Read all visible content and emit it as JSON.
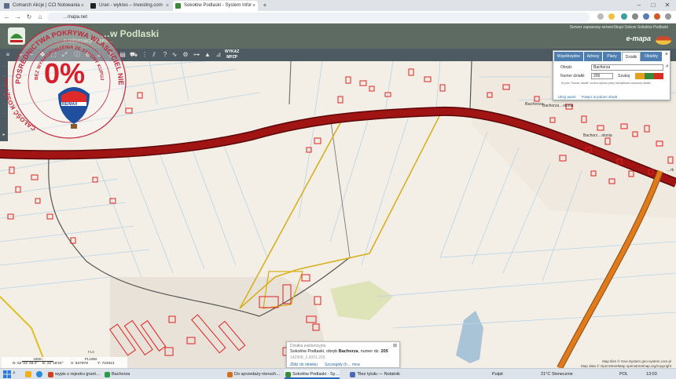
{
  "browser": {
    "tabs": [
      {
        "title": "Comarch Akcje | CCI Notowania",
        "favicon_color": "#5b6b8a"
      },
      {
        "title": "Uran - wykres – Investing.com",
        "favicon_color": "#222222"
      },
      {
        "title": "Sokołów Podlaski - System Infor",
        "favicon_color": "#3a8a3a",
        "active": true
      }
    ],
    "new_tab": "+",
    "address": "…mapa.net",
    "window_controls": [
      "–",
      "□",
      "✕"
    ]
  },
  "site": {
    "title": "…w Podlaski",
    "subtitle": "…n Informacji Przes…",
    "note": "Serwer zapasowy serwerSkupi Sokow Sokołów Podlaski",
    "brand": "e-mapa"
  },
  "toolbar": {
    "wykaz_line1": "WYKAZ",
    "wykaz_line2": "MPZP"
  },
  "panel": {
    "tabs": [
      "Współrzędne",
      "Adresy",
      "Plany",
      "Działki",
      "Obiekty"
    ],
    "active_tab": "Działki",
    "obreb_label": "Obręb:",
    "obreb_value": "Bachorza",
    "numer_label": "Numer działki:",
    "numer_value": "205",
    "search_label": "Szukaj",
    "hint": "W polu \"Numer działki\" można wpisać pełny identyfikator szukanej działki.",
    "link_hide": "Ukryj panel",
    "link_join": "Połącz w jedomi obręb"
  },
  "map_labels": {
    "village1": "Bachorza",
    "village2": "Bachorza…olonia",
    "village3": "Bachorz…olonia",
    "edge": "…rk",
    "road_code": "FL9"
  },
  "promo": {
    "arc_text": "POSREDNICTWA POKRYWA WLASCICIEL NIERUCHOMOSCI",
    "inner_text": "BEZ WYNAGRODZENIA ZE STRONY KUPUJĄCEGO",
    "left_text": "CAŁOŚĆ KOSZTÓW",
    "percent": "0%",
    "brand": "RE/MAX"
  },
  "popup": {
    "heading": "Działka ewidencyjna",
    "line_prefix": "Sokołów Podlaski, obręb ",
    "obreb": "Bachorza",
    "line_mid": ", numer dz. ",
    "numer": "205",
    "teryt": "142908_2.0001.205",
    "link_zoom": "Zbliż do obiektu",
    "link_details": "Szczegóły (h… mna",
    "close": "⊠"
  },
  "coords": {
    "scale": "100m",
    "n": "N: 52°23' 29.2\"",
    "e": "E: 22°18'24\"",
    "x": "X: 537978",
    "y": "Y: 724021",
    "crs": "PL1992"
  },
  "attribution": {
    "line1": "Map tiles © Geo-System geo-system.com.pl",
    "line2": "Map data © OpenStreetMap openstreetmap.org/copyright"
  },
  "taskbar": {
    "search": "⌕",
    "apps": [
      {
        "label": "wypis z rejestru grunt…",
        "color": "#d04020"
      },
      {
        "label": "Bachorza",
        "color": "#2a9a4a"
      },
      {
        "label": "Do sprzedaży nieruch…",
        "color": "#d07020"
      },
      {
        "label": "Sokołów Podlaski - Sy…",
        "color": "#3a8a3a",
        "active": true
      },
      {
        "label": "\"Bez tytułu — Notatnik",
        "color": "#4a6ab8"
      }
    ],
    "input_lang": "Pulpit",
    "weather": "21°C Słonecznie",
    "lang": "POL",
    "time": "13:03"
  },
  "colors": {
    "main_road": "#a01414",
    "orange_road": "#e07a1a",
    "parcel_highlight": "#d8b020",
    "building": "#e02020",
    "map_bg": "#f3efe6"
  }
}
